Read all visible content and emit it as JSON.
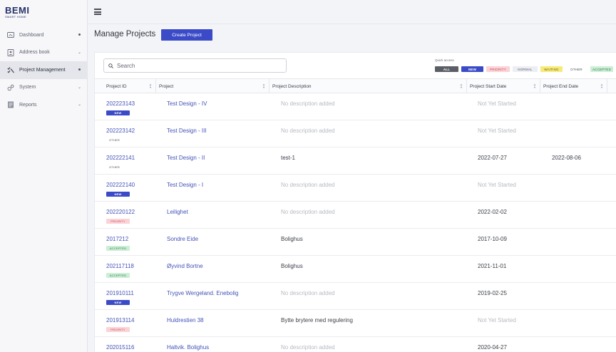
{
  "logo": {
    "main": "BEMI",
    "sub": "SMART HOME"
  },
  "sidebar": {
    "items": [
      {
        "label": "Dashboard",
        "icon": "dashboard-icon",
        "indicator": "dot"
      },
      {
        "label": "Address book",
        "icon": "contact-book-icon",
        "indicator": "chevron"
      },
      {
        "label": "Project Management",
        "icon": "checklist-icon",
        "indicator": "dot",
        "active": true
      },
      {
        "label": "System",
        "icon": "gears-icon",
        "indicator": "chevron"
      },
      {
        "label": "Reports",
        "icon": "report-icon",
        "indicator": "chevron"
      }
    ]
  },
  "header": {
    "title": "Manage Projects",
    "create_label": "Create Project"
  },
  "search": {
    "placeholder": "Search",
    "value": ""
  },
  "quick_access": {
    "label": "Quick access",
    "filters": [
      "ALL",
      "NEW",
      "PRIORITY",
      "NORMAL",
      "WAITING",
      "OTHER",
      "ACCEPTED"
    ]
  },
  "table": {
    "columns": [
      "Project ID",
      "Project",
      "Project Description",
      "Project Start Date",
      "Project End Date"
    ],
    "rows": [
      {
        "id": "202223143",
        "badge": "NEW",
        "project": "Test Design - IV",
        "description": "No description added",
        "start": "Not Yet Started",
        "end": ""
      },
      {
        "id": "202223142",
        "badge": "OTHER",
        "project": "Test Design - III",
        "description": "No description added",
        "start": "Not Yet Started",
        "end": ""
      },
      {
        "id": "202222141",
        "badge": "OTHER",
        "project": "Test Design - II",
        "description": "test-1",
        "start": "2022-07-27",
        "end": "2022-08-06"
      },
      {
        "id": "202222140",
        "badge": "NEW",
        "project": "Test Design - I",
        "description": "No description added",
        "start": "Not Yet Started",
        "end": ""
      },
      {
        "id": "202220122",
        "badge": "PRIORITY",
        "project": "Leilighet",
        "description": "No description added",
        "start": "2022-02-02",
        "end": ""
      },
      {
        "id": "2017212",
        "badge": "ACCEPTED",
        "project": "Sondre Eide",
        "description": "Bolighus",
        "start": "2017-10-09",
        "end": ""
      },
      {
        "id": "202117118",
        "badge": "ACCEPTED",
        "project": "Øyvind Bortne",
        "description": "Bolighus",
        "start": "2021-11-01",
        "end": ""
      },
      {
        "id": "201910111",
        "badge": "NEW",
        "project": "Trygve Wergeland. Enebolig",
        "description": "No description added",
        "start": "2019-02-25",
        "end": ""
      },
      {
        "id": "201913114",
        "badge": "PRIORITY",
        "project": "Huldrestien 38",
        "description": "Bytte brytere med regulering",
        "start": "Not Yet Started",
        "end": ""
      },
      {
        "id": "202015116",
        "badge": "",
        "project": "Haltvik. Bolighus",
        "description": "No description added",
        "start": "2020-04-27",
        "end": ""
      }
    ]
  },
  "colors": {
    "accent": "#3b4bc8",
    "link": "#4453b8",
    "muted": "#b7bac2",
    "priority_bg": "#fbd3d7",
    "accepted_bg": "#cdeed6",
    "waiting_bg": "#f6ea7a"
  }
}
